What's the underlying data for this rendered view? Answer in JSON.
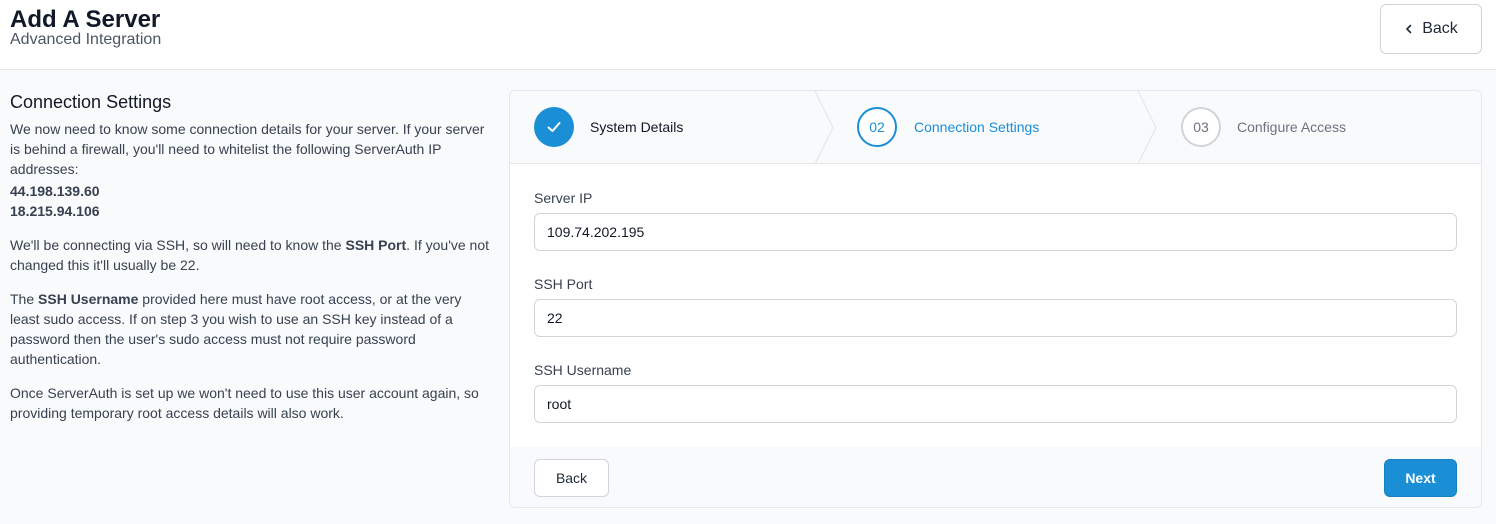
{
  "header": {
    "title": "Add A Server",
    "subtitle": "Advanced Integration",
    "back_label": "Back"
  },
  "info": {
    "heading": "Connection Settings",
    "intro": "We now need to know some connection details for your server. If your server is behind a firewall, you'll need to whitelist the following ServerAuth IP addresses:",
    "ips": [
      "44.198.139.60",
      "18.215.94.106"
    ],
    "ssh_port_pre": "We'll be connecting via SSH, so will need to know the ",
    "ssh_port_bold": "SSH Port",
    "ssh_port_post": ". If you've not changed this it'll usually be 22.",
    "username_pre": "The ",
    "username_bold": "SSH Username",
    "username_post": " provided here must have root access, or at the very least sudo access. If on step 3 you wish to use an SSH key instead of a password then the user's sudo access must not require password authentication.",
    "closing": "Once ServerAuth is set up we won't need to use this user account again, so providing temporary root access details will also work."
  },
  "steps": [
    {
      "number": "",
      "label": "System Details",
      "state": "complete"
    },
    {
      "number": "02",
      "label": "Connection Settings",
      "state": "current"
    },
    {
      "number": "03",
      "label": "Configure Access",
      "state": "upcoming"
    }
  ],
  "form": {
    "server_ip": {
      "label": "Server IP",
      "value": "109.74.202.195"
    },
    "ssh_port": {
      "label": "SSH Port",
      "value": "22"
    },
    "ssh_username": {
      "label": "SSH Username",
      "value": "root"
    }
  },
  "footer": {
    "back_label": "Back",
    "next_label": "Next"
  },
  "colors": {
    "accent": "#1a8fd6",
    "border": "#e5e7eb"
  }
}
